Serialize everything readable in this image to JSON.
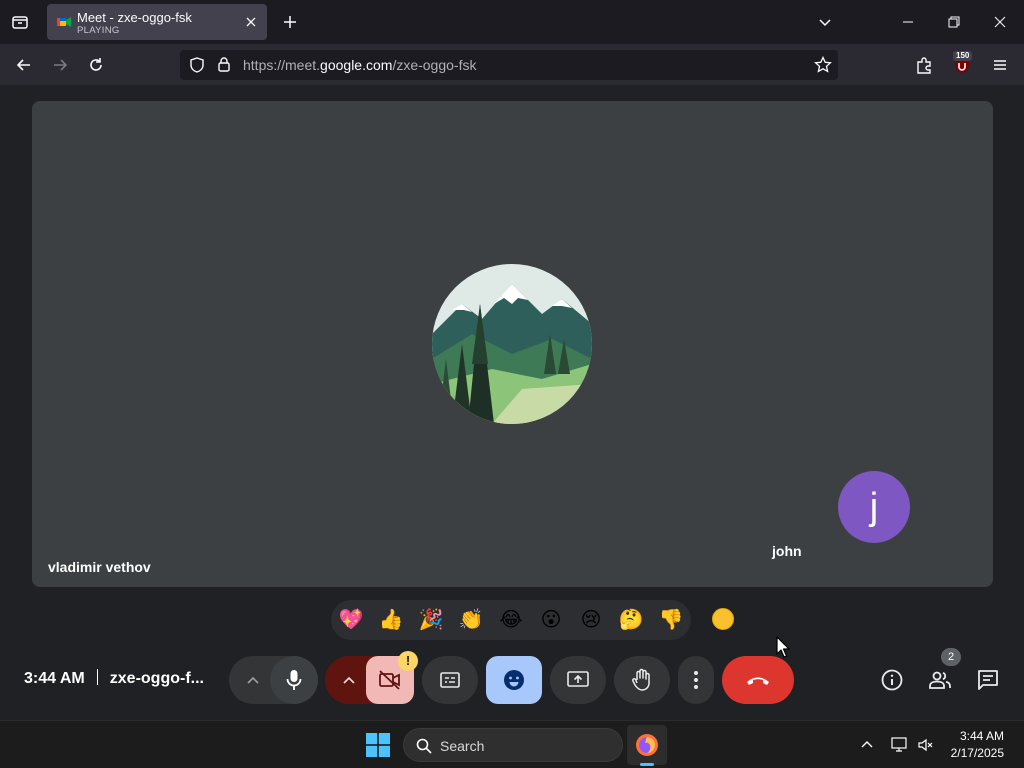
{
  "browser": {
    "tab": {
      "title": "Meet - zxe-oggo-fsk",
      "status": "PLAYING"
    },
    "url": {
      "prefix": "https://meet.",
      "domain": "google.com",
      "path": "/zxe-oggo-fsk"
    },
    "extension_badge": "150",
    "icons": [
      "tab-list-icon",
      "close-icon",
      "plus-icon",
      "chevron-down-icon",
      "minimize-icon",
      "restore-icon",
      "close-window-icon",
      "back-arrow-icon",
      "forward-arrow-icon",
      "reload-icon",
      "shield-icon",
      "lock-icon",
      "star-icon",
      "extensions-icon",
      "ublock-icon",
      "menu-icon"
    ]
  },
  "meeting": {
    "main_participant": "vladimir vethov",
    "self_participant": "john",
    "self_initial": "j",
    "avatar_color": "#7e57c2",
    "time": "3:44 AM",
    "code": "zxe-oggo-f...",
    "warning_badge": "!",
    "people_count": "2",
    "reactions": [
      "💖",
      "👍",
      "🎉",
      "👏",
      "😂",
      "😮",
      "😢",
      "🤔",
      "👎"
    ],
    "hangup_color": "#ea4335"
  },
  "taskbar": {
    "search_label": "Search",
    "time": "3:44 AM",
    "date": "2/17/2025"
  }
}
